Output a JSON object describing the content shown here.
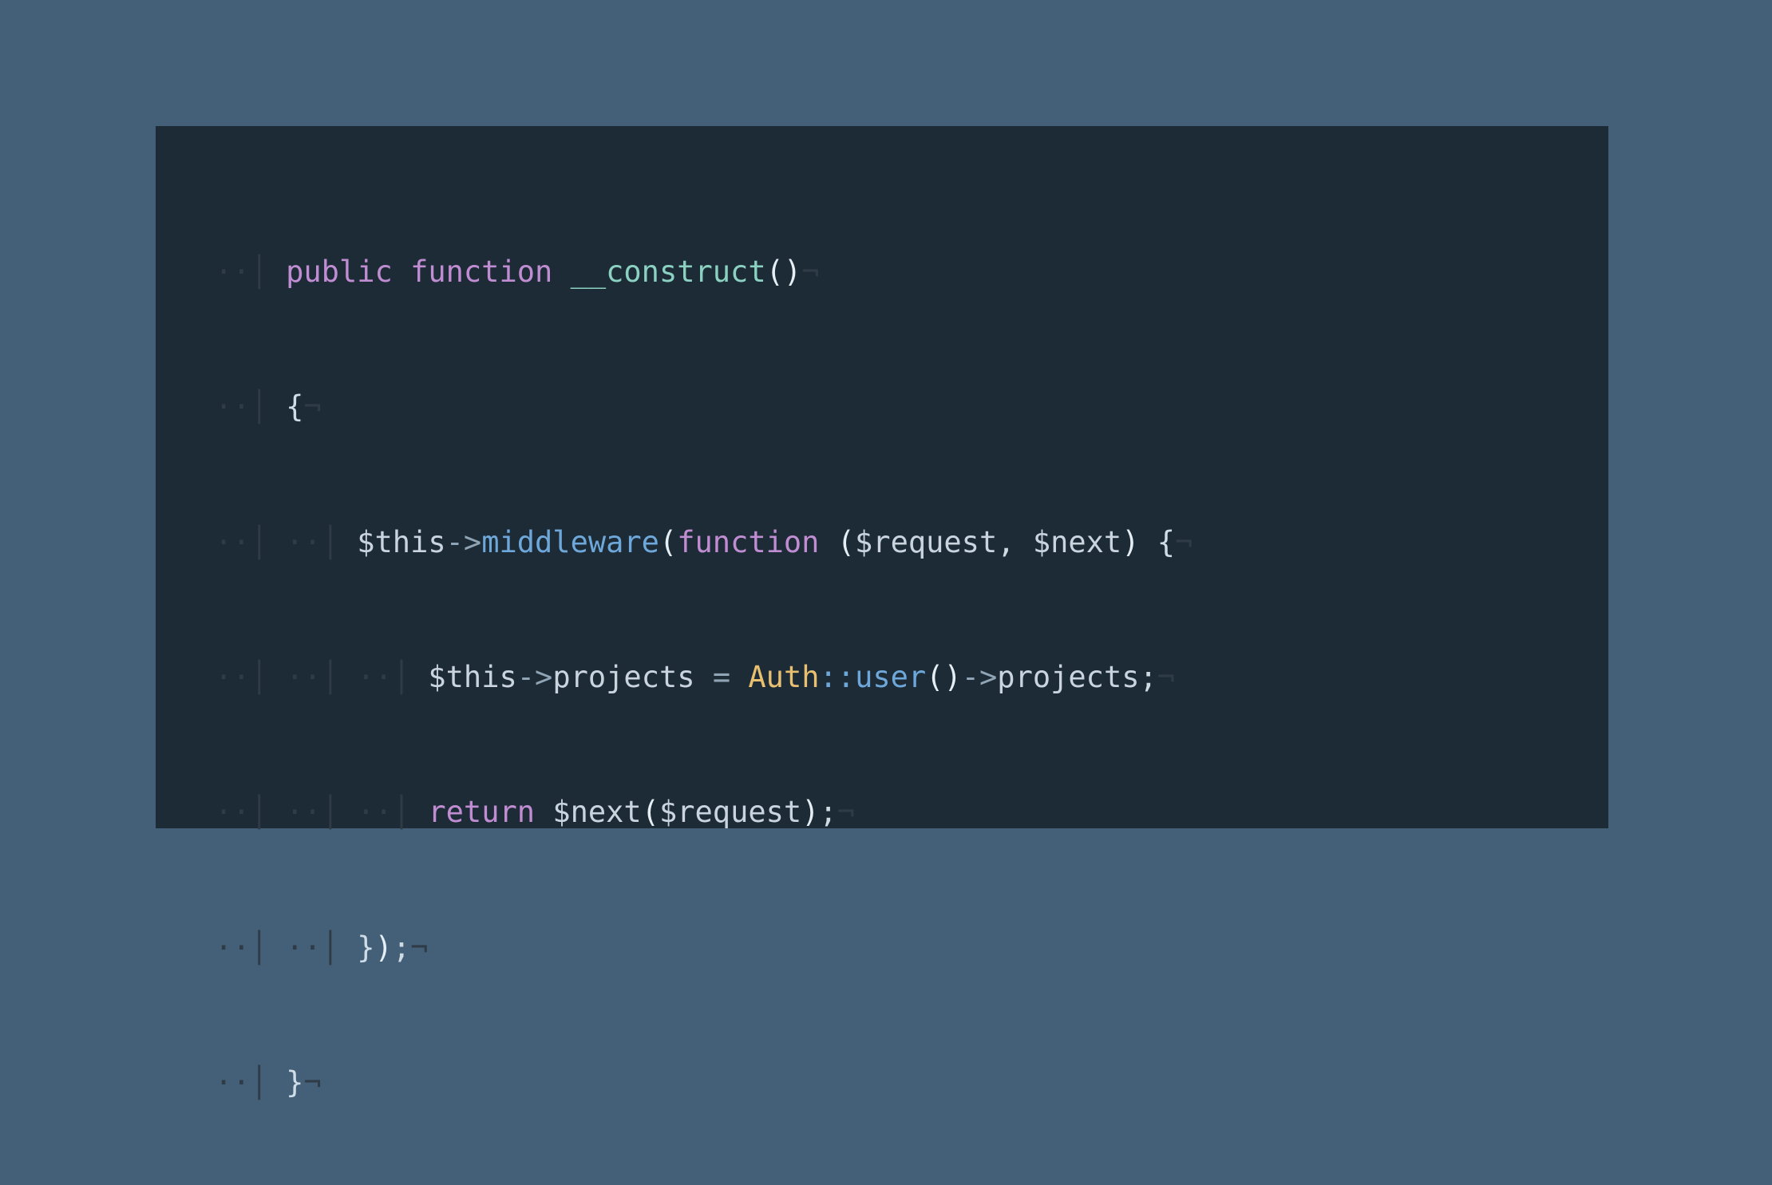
{
  "code": {
    "kw_public": "public",
    "kw_function": "function",
    "kw_function2": "function",
    "kw_return": "return",
    "fn_construct": "__construct",
    "m_middleware": "middleware",
    "p_request": "$request",
    "p_next": "$next",
    "v_this": "$this",
    "v_this2": "$this",
    "prop_projects": "projects",
    "cls_auth": "Auth",
    "m_user": "user",
    "m_projects": "projects",
    "v_next": "$next",
    "v_request": "$request",
    "lp": "(",
    "rp": ")",
    "lb": "{",
    "rb": "}",
    "arrow": "->",
    "scope": "::",
    "comma": ",",
    "semi": ";",
    "eq": "=",
    "dot2": "··",
    "dot4": "····",
    "dot6": "······",
    "bar": "│",
    "eol": "¬"
  }
}
